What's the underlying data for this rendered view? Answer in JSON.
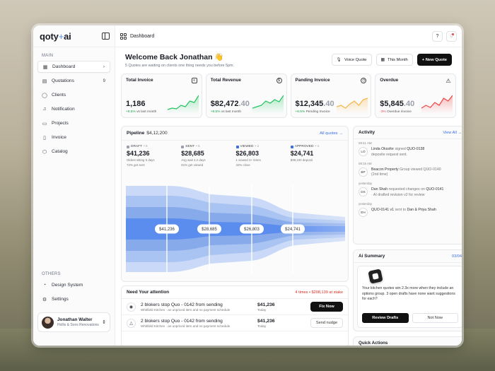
{
  "brand": {
    "name_a": "qoty",
    "name_plus": "+",
    "name_b": "ai"
  },
  "sidebar": {
    "main_label": "MAIN",
    "items": [
      {
        "label": "Dashboard",
        "right": "›",
        "icon": "grid-icon"
      },
      {
        "label": "Quotations",
        "right": "9",
        "icon": "document-icon"
      },
      {
        "label": "Clients",
        "icon": "user-icon"
      },
      {
        "label": "Notification",
        "icon": "bell-icon"
      },
      {
        "label": "Projects",
        "icon": "folder-icon"
      },
      {
        "label": "Invoice",
        "icon": "invoice-icon"
      },
      {
        "label": "Catalog",
        "icon": "box-icon"
      }
    ],
    "others_label": "OTHERS",
    "others": [
      {
        "label": "Design System",
        "icon": "palette-icon"
      },
      {
        "label": "Settings",
        "icon": "gear-icon"
      }
    ],
    "user": {
      "name": "Jonathan Walter",
      "company": "Hollis & Sons Renovations"
    }
  },
  "topbar": {
    "crumb": "Dashboard"
  },
  "welcome": {
    "title": "Welcome Back Jonathan 👋",
    "subtitle": "5 Quotes are waiting on clients one thing needs you before 5pm."
  },
  "header_buttons": {
    "voice": "Voice Quote",
    "month": "This Month",
    "new": "+ New Quote"
  },
  "kpis": [
    {
      "title": "Total Invoice",
      "value_main": "1,186",
      "value_dec": "",
      "delta": "+8.5%",
      "delta_type": "pos",
      "delta_text": " vs last month",
      "color": "#22c55e"
    },
    {
      "title": "Total Revenue",
      "value_main": "$82,472",
      "value_dec": ".40",
      "delta": "+8.5%",
      "delta_type": "pos",
      "delta_text": " vs last month",
      "color": "#22c55e"
    },
    {
      "title": "Panding Invoice",
      "value_main": "$12,345",
      "value_dec": ".40",
      "delta": "+6.5%",
      "delta_type": "pos",
      "delta_text": " Pending Invoice",
      "color": "#f5b544"
    },
    {
      "title": "Overdue",
      "value_main": "$5,845",
      "value_dec": ".40",
      "delta": "-3%",
      "delta_type": "neg",
      "delta_text": " Overdue invoice",
      "color": "#ef4444"
    }
  ],
  "pipeline": {
    "title": "Pipeline",
    "amount": "$4,12,200",
    "link": "All quotes →",
    "stages": [
      {
        "label": "DRAFT",
        "count": "• 5",
        "value": "$41,236",
        "note1": "Oldest sitting 5 days",
        "note2": "72% get sent",
        "color": "#9aa0ab"
      },
      {
        "label": "SENT",
        "count": "• 5",
        "value": "$28,685",
        "note1": "Avg wait 3.2 days",
        "note2": "81% get viewed",
        "color": "#9aa0ab"
      },
      {
        "label": "VIEWED",
        "count": "• 2",
        "value": "$26,803",
        "note1": "1 viewed 3+ times",
        "note2": "42% close",
        "color": "#3b6ee6"
      },
      {
        "label": "APPROVED",
        "count": "• 4",
        "value": "$24,741",
        "note1": "$39,100 deposit",
        "note2": "",
        "color": "#3b6ee6"
      }
    ],
    "funnel_labels": [
      "$41,236",
      "$28,685",
      "$26,803",
      "$24,741"
    ]
  },
  "attention": {
    "title": "Need Your attention",
    "stat": "4 times • $208,139 at stake",
    "rows": [
      {
        "title": "2 blokers stop Quo - 0142 from sending",
        "desc": "Whitfield Kitchen · an unpriced item and no payment schedule",
        "amount": "$41,236",
        "time": "Today",
        "button": "Fix Now",
        "dark": true,
        "icon": "eye-icon"
      },
      {
        "title": "2 blokers stop Quo - 0142 from sending",
        "desc": "Whitfield Kitchen · an unpriced item and no payment schedule",
        "amount": "$41,236",
        "time": "Today",
        "button": "Send nudge",
        "dark": false,
        "icon": "warning-icon"
      }
    ]
  },
  "activity": {
    "title": "Activity",
    "link": "View All →",
    "items": [
      {
        "time": "09:41 AM",
        "av": "LO",
        "who": "Linda Okssfor",
        "verb": " signed ",
        "obj": "QUO-0138",
        "sub": "deposite request sent."
      },
      {
        "time": "08:15 AM",
        "av": "BP",
        "who": "Beacon Property",
        "verb": " Group viewed QUO-0140 ",
        "obj": "",
        "sub": "(2nd time)"
      },
      {
        "time": "yesterday",
        "av": "DS",
        "who": "Dan Shah",
        "verb": " requested changes on ",
        "obj": "QUO-0141",
        "sub": "· AI drafted revision v2 for review"
      },
      {
        "time": "yesterday",
        "av": "EH",
        "who": "QUO-0141 v1",
        "verb": " sent to ",
        "obj": "Dan & Priya Shah",
        "sub": ""
      }
    ]
  },
  "ai_summary": {
    "title": "Ai Summary",
    "count": "03/04",
    "text": "Your kitchen quotes win 2.3x more when they include an options group. 3 open drafts have none want suggestions for each?",
    "review": "Review Drafts",
    "not_now": "Not Now"
  },
  "quick_actions": {
    "title": "Quick Actions"
  }
}
